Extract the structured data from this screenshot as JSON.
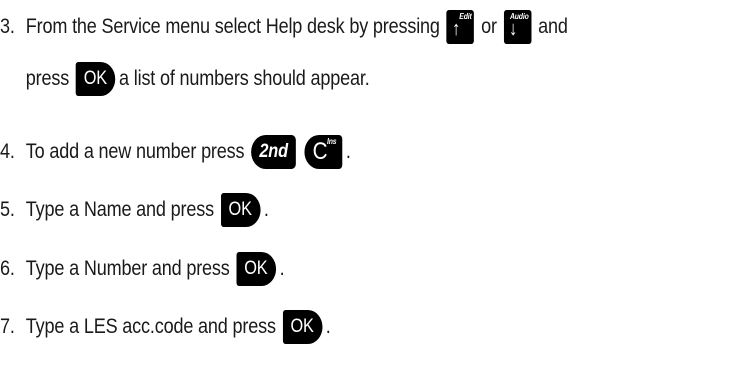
{
  "steps": [
    {
      "number": "3.",
      "line1_text": "From the Service menu select Help desk by pressing",
      "or_text": "or",
      "and_text": "and",
      "line2_pre": "press",
      "line2_post": "a list of numbers should appear."
    },
    {
      "number": "4.",
      "text": "To add a new number press",
      "end": "."
    },
    {
      "number": "5.",
      "text": "Type a Name and press",
      "end": "."
    },
    {
      "number": "6.",
      "text": "Type a Number and press",
      "end": "."
    },
    {
      "number": "7.",
      "text": "Type a LES acc.code and press",
      "end": "."
    }
  ],
  "keys": {
    "ok": "OK",
    "second": "2nd",
    "c_main": "C",
    "c_sup": "Ins",
    "up_main": "↑",
    "up_sup": "Edit",
    "down_main": "↓",
    "down_sup": "Audio"
  },
  "icons": {
    "up": "arrow-up-icon",
    "down": "arrow-down-icon"
  }
}
